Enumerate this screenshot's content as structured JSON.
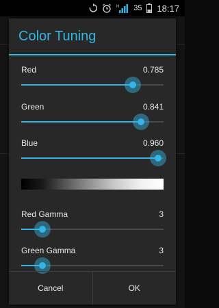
{
  "statusbar": {
    "battery_level": "35",
    "time": "18:17",
    "icons": [
      "sync-icon",
      "alarm-icon",
      "h-network-icon",
      "signal-icon",
      "battery-icon"
    ]
  },
  "dialog": {
    "title": "Color Tuning",
    "accent_color": "#33b5e5",
    "sliders": [
      {
        "label": "Red",
        "value_text": "0.785",
        "fraction": 0.785
      },
      {
        "label": "Green",
        "value_text": "0.841",
        "fraction": 0.841
      },
      {
        "label": "Blue",
        "value_text": "0.960",
        "fraction": 0.96
      },
      {
        "label": "Red Gamma",
        "value_text": "3",
        "fraction": 0.15
      },
      {
        "label": "Green Gamma",
        "value_text": "3",
        "fraction": 0.15
      }
    ],
    "buttons": {
      "cancel": "Cancel",
      "ok": "OK"
    }
  }
}
